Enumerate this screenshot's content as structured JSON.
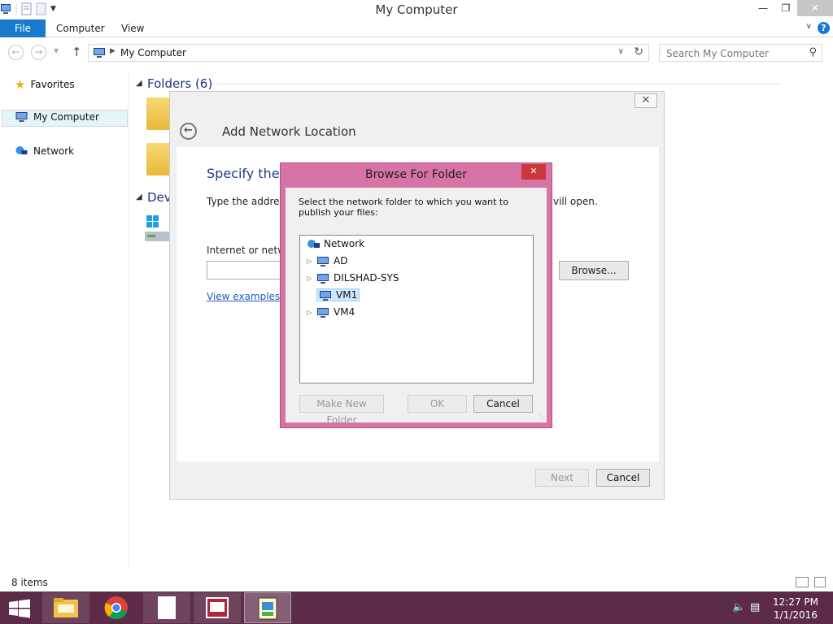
{
  "window": {
    "title": "My Computer"
  },
  "ribbon": {
    "tabs": [
      "File",
      "Computer",
      "View"
    ]
  },
  "address": {
    "path": "My Computer",
    "search_placeholder": "Search My Computer"
  },
  "navpane": {
    "favorites": "Favorites",
    "my_computer": "My Computer",
    "network": "Network"
  },
  "content": {
    "folders_heading": "Folders (6)",
    "devices_heading": "Dev"
  },
  "status": {
    "items": "8 items"
  },
  "wizard": {
    "title": "Add Network Location",
    "heading": "Specify the lo",
    "description": "Type the address",
    "description_tail": "vill open.",
    "field_label": "Internet or netwo",
    "browse_label": "Browse...",
    "examples_link": "View examples",
    "next_label": "Next",
    "cancel_label": "Cancel"
  },
  "browse_dialog": {
    "title": "Browse For Folder",
    "description": "Select the network folder to which you want to publish your files:",
    "tree": {
      "root": "Network",
      "items": [
        "AD",
        "DILSHAD-SYS",
        "VM1",
        "VM4"
      ],
      "selected": "VM1"
    },
    "make_folder_label": "Make New Folder",
    "ok_label": "OK",
    "cancel_label": "Cancel"
  },
  "taskbar": {
    "time": "12:27 PM",
    "date": "1/1/2016"
  },
  "colors": {
    "accent": "#1979ca",
    "taskbar": "#5c2b47",
    "dialog_frame": "#d773a5",
    "close_red": "#c9383a"
  }
}
